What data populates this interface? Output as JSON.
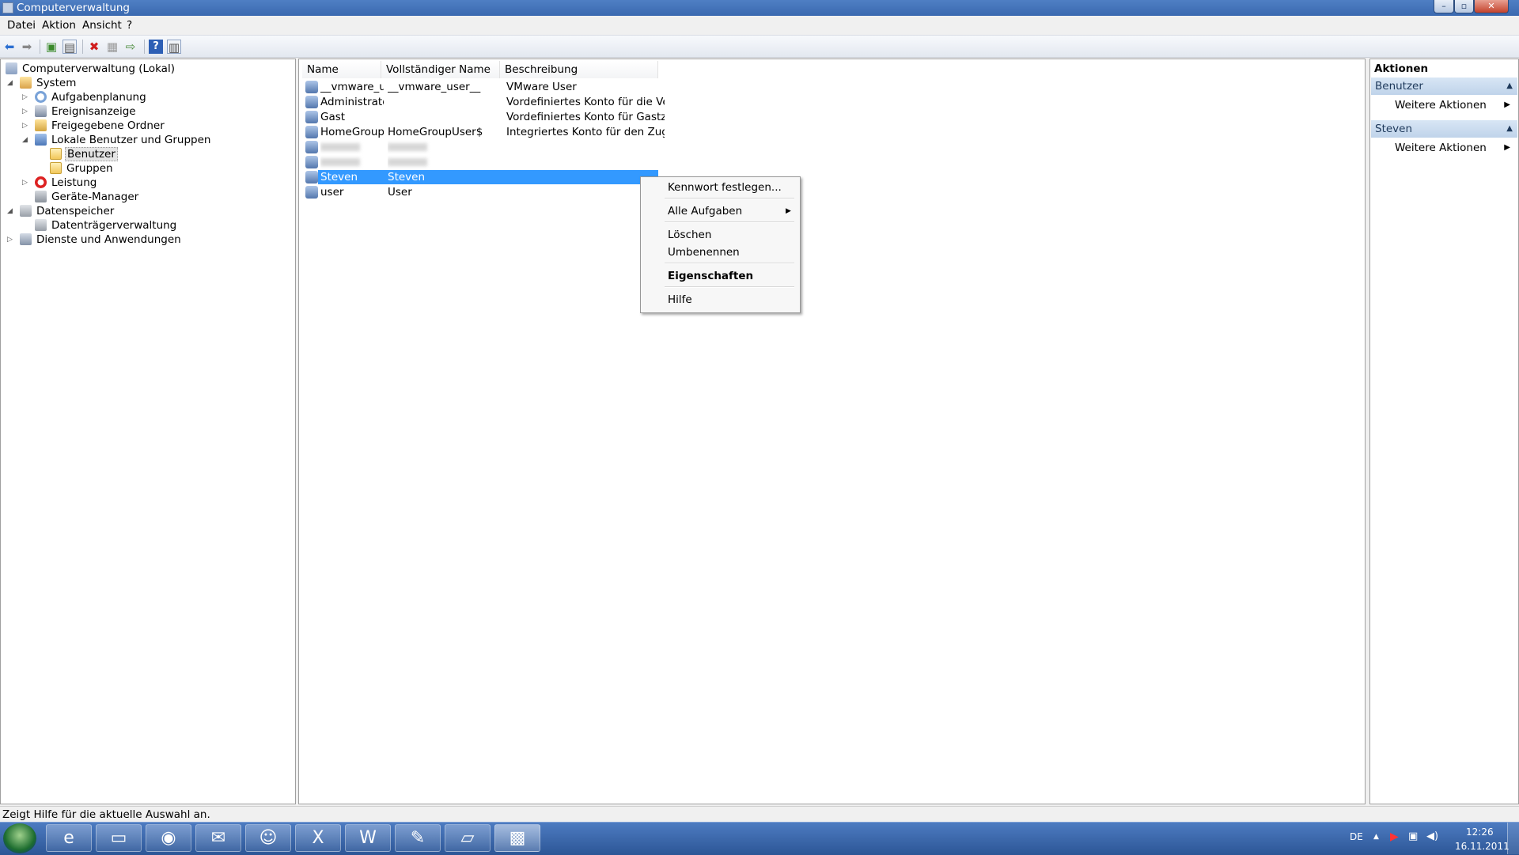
{
  "window": {
    "title": "Computerverwaltung",
    "min": "–",
    "max": "▫",
    "close": "✕"
  },
  "menu": [
    "Datei",
    "Aktion",
    "Ansicht",
    "?"
  ],
  "tree": {
    "root": "Computerverwaltung (Lokal)",
    "system": "System",
    "aufgabenplanung": "Aufgabenplanung",
    "ereignisanzeige": "Ereignisanzeige",
    "freigegebene": "Freigegebene Ordner",
    "lokale": "Lokale Benutzer und Gruppen",
    "benutzer": "Benutzer",
    "gruppen": "Gruppen",
    "leistung": "Leistung",
    "geraete": "Geräte-Manager",
    "datenspeicher": "Datenspeicher",
    "datentraeger": "Datenträgerverwaltung",
    "dienste": "Dienste und Anwendungen"
  },
  "list": {
    "headers": [
      "Name",
      "Vollständiger Name",
      "Beschreibung"
    ],
    "rows": [
      {
        "name": "__vmware_u...",
        "full": "__vmware_user__",
        "desc": "VMware User"
      },
      {
        "name": "Administrator",
        "full": "",
        "desc": "Vordefiniertes Konto für die Verw..."
      },
      {
        "name": "Gast",
        "full": "",
        "desc": "Vordefiniertes Konto für Gastzugri..."
      },
      {
        "name": "HomeGroup...",
        "full": "HomeGroupUser$",
        "desc": "Integriertes Konto für den Zugriff ..."
      },
      {
        "name": "",
        "full": "",
        "desc": ""
      },
      {
        "name": "",
        "full": "",
        "desc": ""
      },
      {
        "name": "Steven",
        "full": "Steven",
        "desc": ""
      },
      {
        "name": "user",
        "full": "User",
        "desc": ""
      }
    ]
  },
  "context_menu": {
    "kennwort": "Kennwort festlegen...",
    "alle": "Alle Aufgaben",
    "loeschen": "Löschen",
    "umbenennen": "Umbenennen",
    "eigenschaften": "Eigenschaften",
    "hilfe": "Hilfe"
  },
  "actions": {
    "title": "Aktionen",
    "section1": "Benutzer",
    "section1_item": "Weitere Aktionen",
    "section2": "Steven",
    "section2_item": "Weitere Aktionen"
  },
  "status": "Zeigt Hilfe für die aktuelle Auswahl an.",
  "tray": {
    "lang": "DE",
    "time": "12:26",
    "date": "16.11.2011"
  },
  "taskbar_apps": [
    "internet-explorer",
    "explorer",
    "firefox",
    "outlook",
    "messenger",
    "excel",
    "word",
    "notepad",
    "virtual-pc",
    "toolbox"
  ]
}
